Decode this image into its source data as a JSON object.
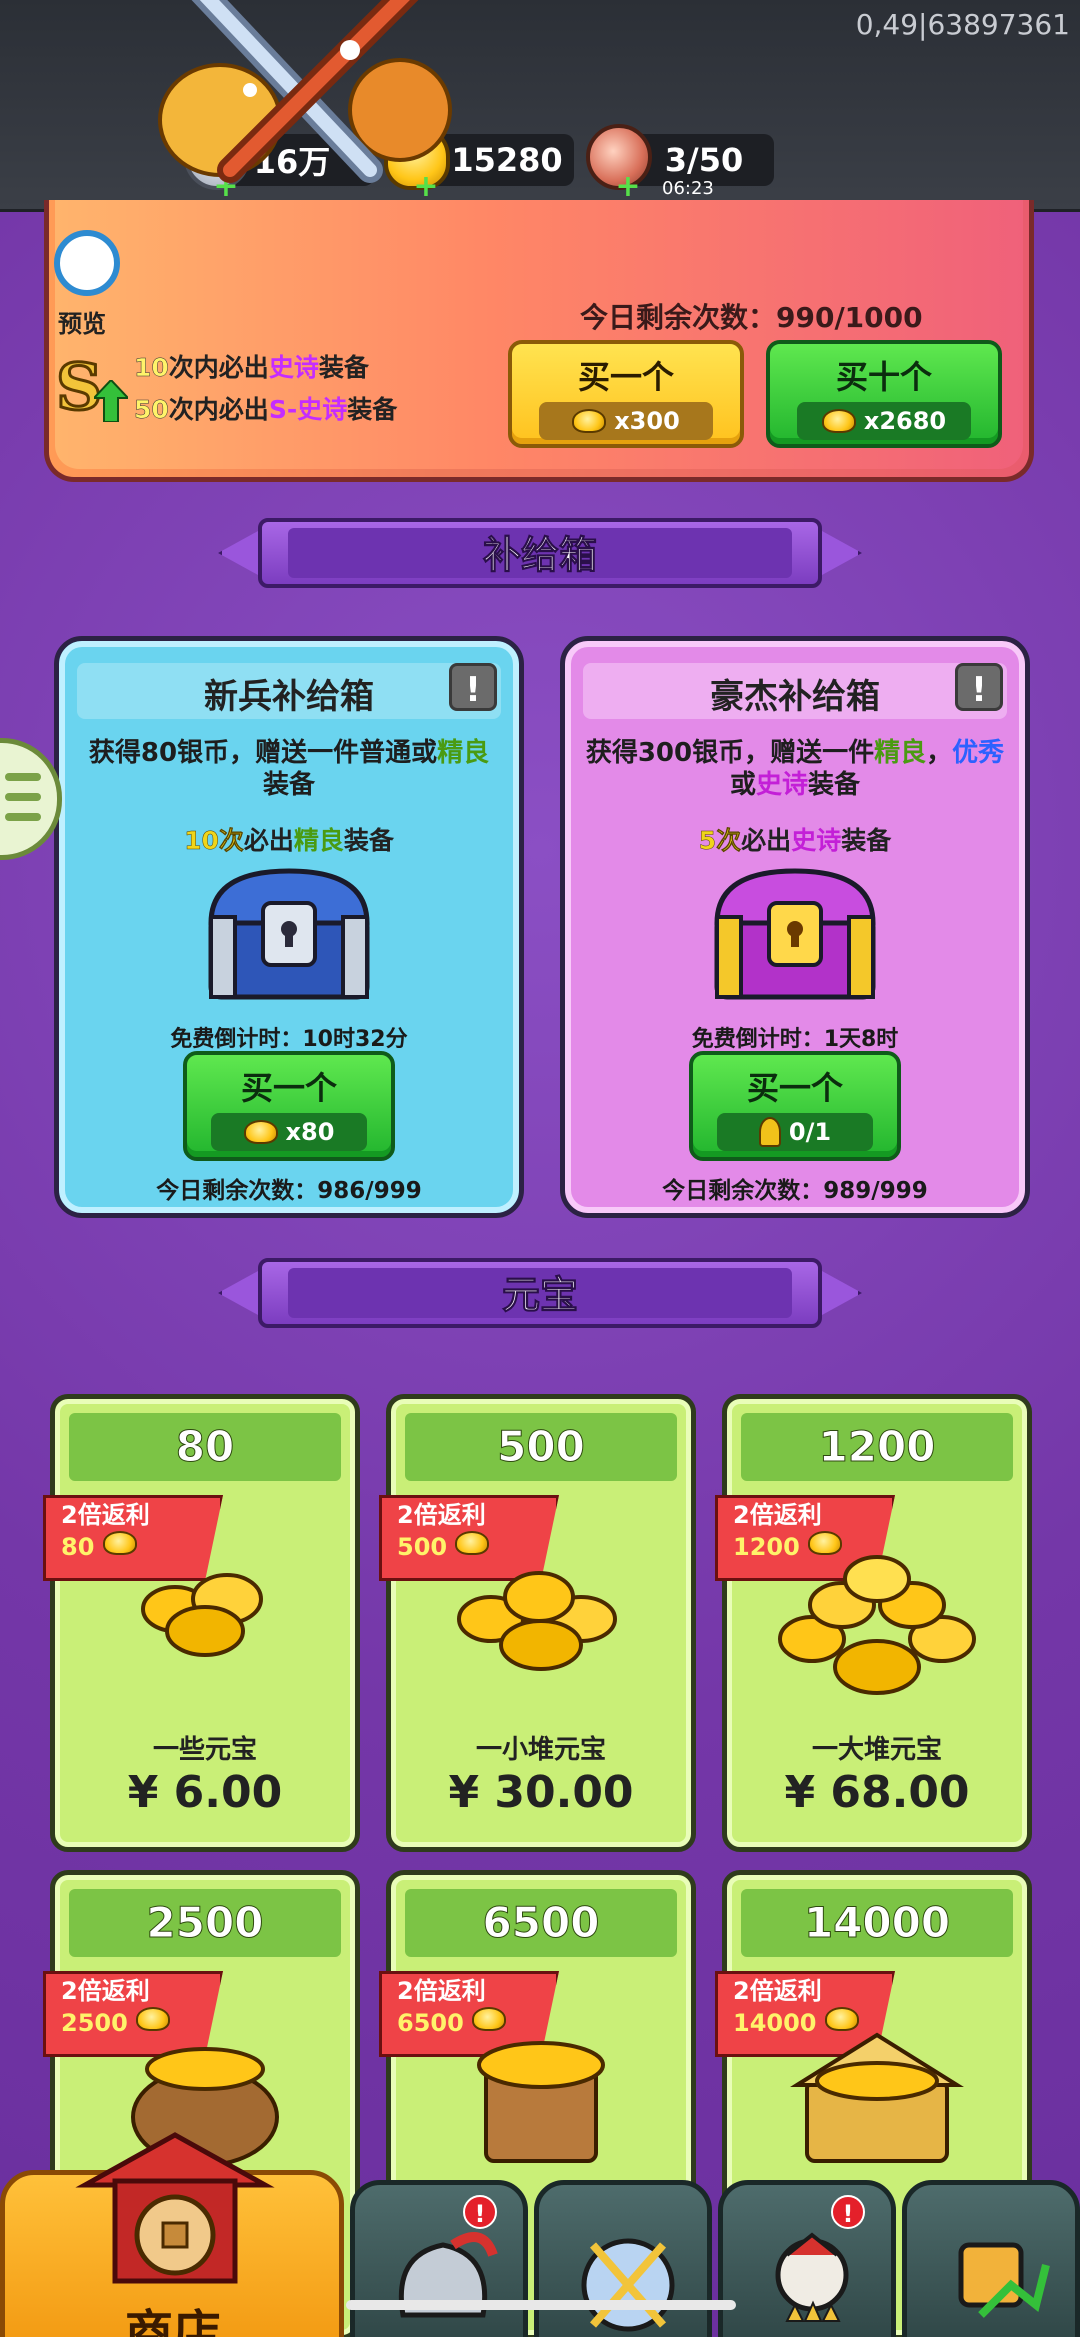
{
  "status": {
    "text": "0,49|63897361"
  },
  "resources": {
    "silver": {
      "value": "16万",
      "icon": "silver-coin-icon"
    },
    "gold": {
      "value": "15280",
      "icon": "gold-ingot-icon"
    },
    "stamina": {
      "value": "3/50",
      "timer": "06:23",
      "icon": "meat-icon"
    }
  },
  "banner": {
    "preview_label": "预览",
    "guarantee_lines": [
      {
        "num": "10",
        "pre": "次内必出",
        "hl": "史诗",
        "post": "装备"
      },
      {
        "num": "50",
        "pre": "次内必出",
        "hl": "S-史诗",
        "post": "装备"
      }
    ],
    "today_remaining": "今日剩余次数：990/1000",
    "buy_one": {
      "label": "买一个",
      "price": "x300"
    },
    "buy_ten": {
      "label": "买十个",
      "price": "x2680"
    }
  },
  "sections": {
    "supply": "补给箱",
    "ingot": "元宝"
  },
  "supply_boxes": [
    {
      "title": "新兵补给箱",
      "desc_a": "获得80银币，赠送一件普通或",
      "desc_hl1": "精良",
      "desc_b": "装备",
      "guarantee_num": "10次",
      "guarantee_mid": "必出",
      "guarantee_hl": "精良",
      "guarantee_post": "装备",
      "countdown": "免费倒计时：10时32分",
      "buy_label": "买一个",
      "price": "x80",
      "today": "今日剩余次数：986/999",
      "info": "!"
    },
    {
      "title": "豪杰补给箱",
      "desc_a": "获得300银币，赠送一件",
      "desc_hl1": "精良",
      "desc_sep": "，",
      "desc_hl2": "优秀",
      "desc_or": "或",
      "desc_hl3": "史诗",
      "desc_b": "装备",
      "guarantee_num": "5次",
      "guarantee_mid": "必出",
      "guarantee_hl": "史诗",
      "guarantee_post": "装备",
      "countdown": "免费倒计时：1天8时",
      "buy_label": "买一个",
      "price": "0/1",
      "today": "今日剩余次数：989/999",
      "info": "!"
    }
  ],
  "gold_packs": [
    {
      "amount": "80",
      "bonus_label": "2倍返利",
      "bonus": "80",
      "name": "一些元宝",
      "price": "¥ 6.00"
    },
    {
      "amount": "500",
      "bonus_label": "2倍返利",
      "bonus": "500",
      "name": "一小堆元宝",
      "price": "¥ 30.00"
    },
    {
      "amount": "1200",
      "bonus_label": "2倍返利",
      "bonus": "1200",
      "name": "一大堆元宝",
      "price": "¥ 68.00"
    },
    {
      "amount": "2500",
      "bonus_label": "2倍返利",
      "bonus": "2500"
    },
    {
      "amount": "6500",
      "bonus_label": "2倍返利",
      "bonus": "6500"
    },
    {
      "amount": "14000",
      "bonus_label": "2倍返利",
      "bonus": "14000"
    }
  ],
  "nav": {
    "shop_label": "商店",
    "badge": "!"
  }
}
